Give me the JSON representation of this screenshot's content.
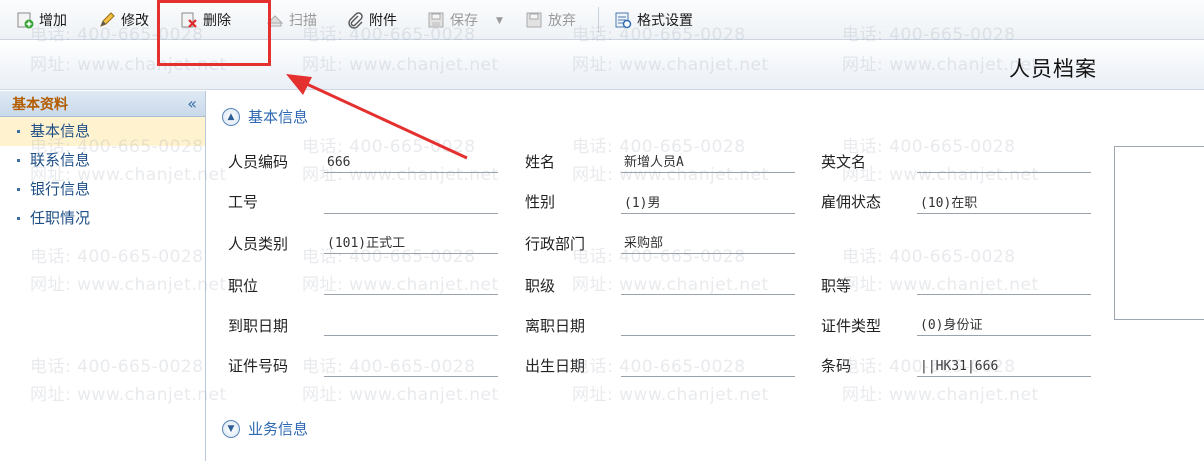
{
  "toolbar": {
    "add": "增加",
    "edit": "修改",
    "delete": "删除",
    "scan": "扫描",
    "attachment": "附件",
    "save": "保存",
    "discard": "放弃",
    "format": "格式设置"
  },
  "page": {
    "title": "人员档案"
  },
  "sidebar": {
    "title": "基本资料",
    "collapse": "«",
    "items": [
      {
        "label": "基本信息"
      },
      {
        "label": "联系信息"
      },
      {
        "label": "银行信息"
      },
      {
        "label": "任职情况"
      }
    ]
  },
  "sections": {
    "basic": "基本信息",
    "business": "业务信息"
  },
  "fields": {
    "emp_code": {
      "label": "人员编码",
      "value": "666"
    },
    "name": {
      "label": "姓名",
      "value": "新增人员A"
    },
    "en_name": {
      "label": "英文名",
      "value": ""
    },
    "job_no": {
      "label": "工号",
      "value": ""
    },
    "gender": {
      "label": "性别",
      "value": "(1)男"
    },
    "employment_status": {
      "label": "雇佣状态",
      "value": "(10)在职"
    },
    "emp_type": {
      "label": "人员类别",
      "value": "(101)正式工"
    },
    "dept": {
      "label": "行政部门",
      "value": "采购部"
    },
    "position": {
      "label": "职位",
      "value": ""
    },
    "rank": {
      "label": "职级",
      "value": ""
    },
    "grade": {
      "label": "职等",
      "value": ""
    },
    "hire_date": {
      "label": "到职日期",
      "value": ""
    },
    "leave_date": {
      "label": "离职日期",
      "value": ""
    },
    "id_type": {
      "label": "证件类型",
      "value": "(0)身份证"
    },
    "id_no": {
      "label": "证件号码",
      "value": ""
    },
    "birth_date": {
      "label": "出生日期",
      "value": ""
    },
    "barcode": {
      "label": "条码",
      "value": "||HK31|666"
    }
  },
  "watermark": {
    "phone": "电话: 400-665-0028",
    "site": "网址: www.chanjet.net"
  },
  "colors": {
    "highlight": "#e53030",
    "link": "#2f69b3",
    "sidebar_title": "#b35c00"
  }
}
